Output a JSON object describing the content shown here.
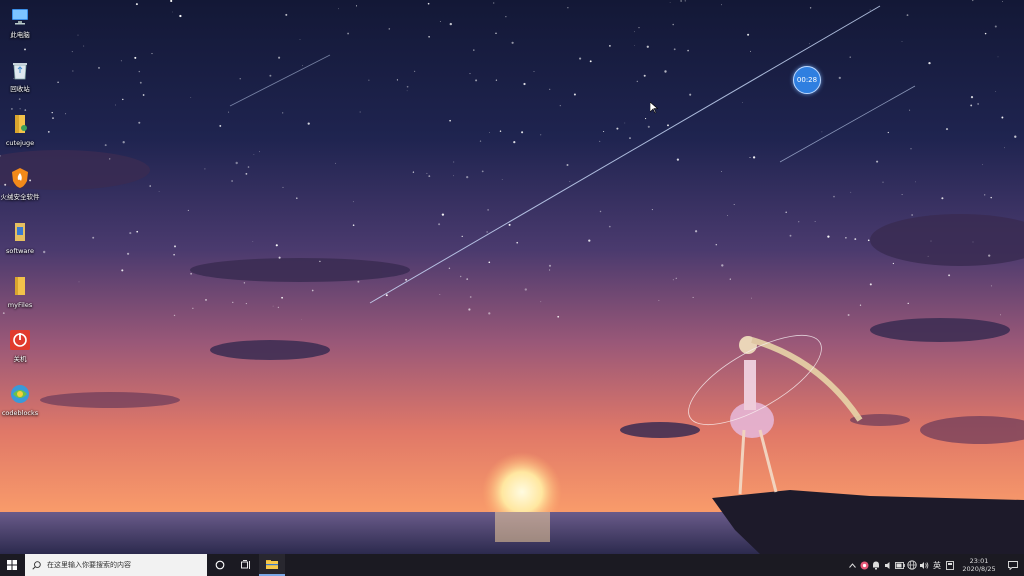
{
  "desktop": {
    "icons": [
      {
        "label": "此电脑",
        "icon": "computer-icon"
      },
      {
        "label": "回收站",
        "icon": "recycle-bin-icon"
      },
      {
        "label": "cutejuge",
        "icon": "user-folder-icon"
      },
      {
        "label": "火绒安全软件",
        "icon": "huorong-security-icon"
      },
      {
        "label": "software",
        "icon": "software-icon"
      },
      {
        "label": "myFiles",
        "icon": "folder-icon"
      },
      {
        "label": "关机",
        "icon": "shutdown-icon"
      },
      {
        "label": "codeblocks",
        "icon": "codeblocks-icon"
      }
    ],
    "timer_text": "00:28"
  },
  "taskbar": {
    "search_placeholder": "在这里输入你要搜索的内容",
    "ime_label": "英",
    "time": "23:01",
    "date": "2020/8/25",
    "icons": [
      "windows-start-icon",
      "search-icon",
      "cortana-icon",
      "task-view-icon",
      "file-explorer-icon"
    ],
    "tray_icons": [
      "show-hidden-icons-icon",
      "app-tray-icon",
      "notification-tray-icon",
      "volume-icon",
      "battery-icon",
      "network-icon",
      "speaker-icon",
      "ime-icon",
      "notification-center-icon"
    ]
  },
  "colors": {
    "taskbar_bg": "#1b1a22",
    "sky_top": "#161a38",
    "sky_bottom": "#f27a60",
    "timer_blue": "#2f7fe0"
  }
}
